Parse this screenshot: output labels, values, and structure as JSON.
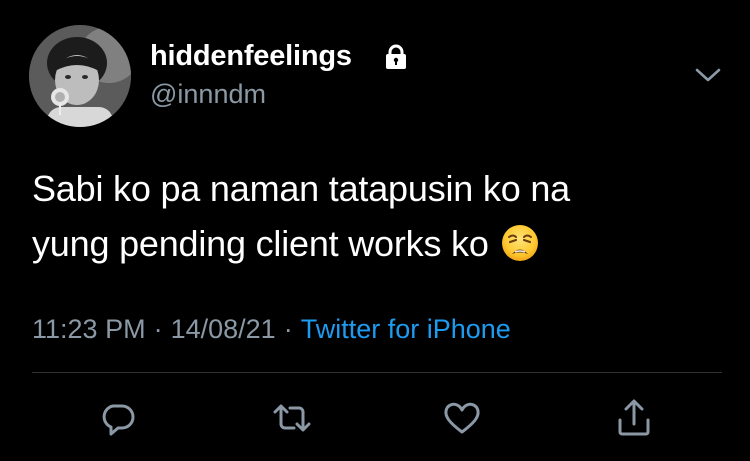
{
  "tweet": {
    "author": {
      "display_name": "hiddenfeelings",
      "handle": "@innndm",
      "protected_icon": "lock-icon",
      "avatar": "avatar"
    },
    "text_lines": [
      "Sabi ko pa naman tatapusin ko na",
      "yung pending client works ko"
    ],
    "emoji": "weary-face-emoji",
    "time": "11:23 PM",
    "separator": "·",
    "date": "14/08/21",
    "source": "Twitter for iPhone",
    "menu_icon": "chevron-down-icon"
  },
  "actions": [
    {
      "name": "reply",
      "icon": "reply-icon"
    },
    {
      "name": "retweet",
      "icon": "retweet-icon"
    },
    {
      "name": "like",
      "icon": "heart-icon"
    },
    {
      "name": "share",
      "icon": "share-icon"
    }
  ],
  "colors": {
    "background": "#000000",
    "text": "#ffffff",
    "secondary_text": "#8b98a5",
    "link": "#1d9bf0",
    "divider": "#2f3336"
  }
}
